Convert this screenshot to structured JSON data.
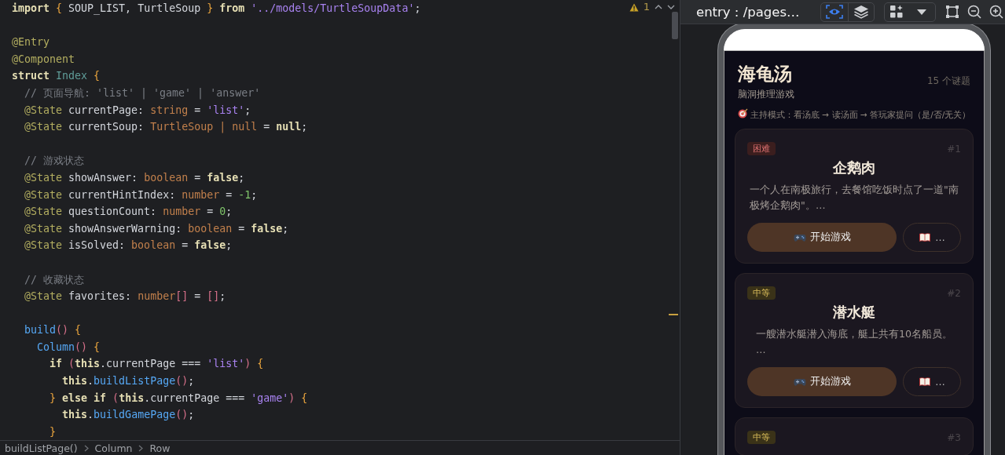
{
  "editor": {
    "warnings": "1",
    "lines": [
      {
        "kind": "code",
        "tokens": [
          {
            "kind": "kw",
            "text": "import "
          },
          {
            "kind": "brace",
            "text": "{"
          },
          {
            "kind": "plain",
            "text": " SOUP_LIST, TurtleSoup "
          },
          {
            "kind": "brace",
            "text": "}"
          },
          {
            "kind": "kw",
            "text": " from "
          },
          {
            "kind": "str",
            "text": "'../models/TurtleSoupData'"
          },
          {
            "kind": "plain",
            "text": ";"
          }
        ]
      },
      {
        "kind": "blank"
      },
      {
        "kind": "code",
        "tokens": [
          {
            "kind": "ann",
            "text": "@Entry"
          }
        ]
      },
      {
        "kind": "code",
        "tokens": [
          {
            "kind": "ann",
            "text": "@Component"
          }
        ]
      },
      {
        "kind": "code",
        "tokens": [
          {
            "kind": "kw",
            "text": "struct "
          },
          {
            "kind": "cls",
            "text": "Index "
          },
          {
            "kind": "brace",
            "text": "{"
          }
        ]
      },
      {
        "kind": "code",
        "tokens": [
          {
            "kind": "comment",
            "text": "  // 页面导航: 'list' | 'game' | 'answer'"
          }
        ]
      },
      {
        "kind": "code",
        "tokens": [
          {
            "kind": "ann",
            "text": "  @State"
          },
          {
            "kind": "plain",
            "text": " currentPage: "
          },
          {
            "kind": "type",
            "text": "string"
          },
          {
            "kind": "plain",
            "text": " = "
          },
          {
            "kind": "str",
            "text": "'list'"
          },
          {
            "kind": "plain",
            "text": ";"
          }
        ]
      },
      {
        "kind": "code",
        "tokens": [
          {
            "kind": "ann",
            "text": "  @State"
          },
          {
            "kind": "plain",
            "text": " currentSoup: "
          },
          {
            "kind": "type",
            "text": "TurtleSoup | null"
          },
          {
            "kind": "plain",
            "text": " = "
          },
          {
            "kind": "kw",
            "text": "null"
          },
          {
            "kind": "plain",
            "text": ";"
          }
        ]
      },
      {
        "kind": "blank"
      },
      {
        "kind": "code",
        "tokens": [
          {
            "kind": "comment",
            "text": "  // 游戏状态"
          }
        ]
      },
      {
        "kind": "code",
        "tokens": [
          {
            "kind": "ann",
            "text": "  @State"
          },
          {
            "kind": "plain",
            "text": " showAnswer: "
          },
          {
            "kind": "type",
            "text": "boolean"
          },
          {
            "kind": "plain",
            "text": " = "
          },
          {
            "kind": "kw",
            "text": "false"
          },
          {
            "kind": "plain",
            "text": ";"
          }
        ]
      },
      {
        "kind": "code",
        "tokens": [
          {
            "kind": "ann",
            "text": "  @State"
          },
          {
            "kind": "plain",
            "text": " currentHintIndex: "
          },
          {
            "kind": "type",
            "text": "number"
          },
          {
            "kind": "plain",
            "text": " = "
          },
          {
            "kind": "num",
            "text": "-1"
          },
          {
            "kind": "plain",
            "text": ";"
          }
        ]
      },
      {
        "kind": "code",
        "tokens": [
          {
            "kind": "ann",
            "text": "  @State"
          },
          {
            "kind": "plain",
            "text": " questionCount: "
          },
          {
            "kind": "type",
            "text": "number"
          },
          {
            "kind": "plain",
            "text": " = "
          },
          {
            "kind": "num",
            "text": "0"
          },
          {
            "kind": "plain",
            "text": ";"
          }
        ]
      },
      {
        "kind": "code",
        "tokens": [
          {
            "kind": "ann",
            "text": "  @State"
          },
          {
            "kind": "plain",
            "text": " showAnswerWarning: "
          },
          {
            "kind": "type",
            "text": "boolean"
          },
          {
            "kind": "plain",
            "text": " = "
          },
          {
            "kind": "kw",
            "text": "false"
          },
          {
            "kind": "plain",
            "text": ";"
          }
        ]
      },
      {
        "kind": "code",
        "tokens": [
          {
            "kind": "ann",
            "text": "  @State"
          },
          {
            "kind": "plain",
            "text": " isSolved: "
          },
          {
            "kind": "type",
            "text": "boolean"
          },
          {
            "kind": "plain",
            "text": " = "
          },
          {
            "kind": "kw",
            "text": "false"
          },
          {
            "kind": "plain",
            "text": ";"
          }
        ]
      },
      {
        "kind": "blank"
      },
      {
        "kind": "code",
        "tokens": [
          {
            "kind": "comment",
            "text": "  // 收藏状态"
          }
        ]
      },
      {
        "kind": "code",
        "tokens": [
          {
            "kind": "ann",
            "text": "  @State"
          },
          {
            "kind": "plain",
            "text": " favorites: "
          },
          {
            "kind": "type",
            "text": "number"
          },
          {
            "kind": "paren",
            "text": "[]"
          },
          {
            "kind": "plain",
            "text": " = "
          },
          {
            "kind": "paren",
            "text": "[]"
          },
          {
            "kind": "plain",
            "text": ";"
          }
        ]
      },
      {
        "kind": "blank"
      },
      {
        "kind": "code",
        "tokens": [
          {
            "kind": "fn",
            "text": "  build"
          },
          {
            "kind": "paren",
            "text": "()"
          },
          {
            "kind": "brace",
            "text": " {"
          }
        ]
      },
      {
        "kind": "code",
        "tokens": [
          {
            "kind": "fn",
            "text": "    Column"
          },
          {
            "kind": "paren",
            "text": "()"
          },
          {
            "kind": "brace",
            "text": " {"
          }
        ]
      },
      {
        "kind": "code",
        "tokens": [
          {
            "kind": "kw",
            "text": "      if "
          },
          {
            "kind": "paren",
            "text": "("
          },
          {
            "kind": "kw",
            "text": "this"
          },
          {
            "kind": "plain",
            "text": ".currentPage === "
          },
          {
            "kind": "str",
            "text": "'list'"
          },
          {
            "kind": "paren",
            "text": ")"
          },
          {
            "kind": "brace",
            "text": " {"
          }
        ]
      },
      {
        "kind": "code",
        "tokens": [
          {
            "kind": "kw",
            "text": "        this"
          },
          {
            "kind": "plain",
            "text": "."
          },
          {
            "kind": "fn",
            "text": "buildListPage"
          },
          {
            "kind": "paren",
            "text": "()"
          },
          {
            "kind": "plain",
            "text": ";"
          }
        ]
      },
      {
        "kind": "code",
        "tokens": [
          {
            "kind": "brace",
            "text": "      }"
          },
          {
            "kind": "kw",
            "text": " else if "
          },
          {
            "kind": "paren",
            "text": "("
          },
          {
            "kind": "kw",
            "text": "this"
          },
          {
            "kind": "plain",
            "text": ".currentPage === "
          },
          {
            "kind": "str",
            "text": "'game'"
          },
          {
            "kind": "paren",
            "text": ")"
          },
          {
            "kind": "brace",
            "text": " {"
          }
        ]
      },
      {
        "kind": "code",
        "tokens": [
          {
            "kind": "kw",
            "text": "        this"
          },
          {
            "kind": "plain",
            "text": "."
          },
          {
            "kind": "fn",
            "text": "buildGamePage"
          },
          {
            "kind": "paren",
            "text": "()"
          },
          {
            "kind": "plain",
            "text": ";"
          }
        ]
      },
      {
        "kind": "code",
        "tokens": [
          {
            "kind": "brace",
            "text": "      }"
          }
        ]
      }
    ],
    "breadcrumbs": [
      "buildListPage()",
      "Column",
      "Row"
    ]
  },
  "preview": {
    "title": "entry : /pages…",
    "view_toggles": [
      {
        "kind": "inspect",
        "selected": true
      },
      {
        "kind": "layers",
        "selected": false
      }
    ],
    "app": {
      "title": "海龟汤",
      "count": "15 个谜题",
      "subtitle": "脑洞推理游戏",
      "mode_hint": "主持模式：看汤底 → 读汤面 → 答玩家提问（是/否/无关）",
      "cards": [
        {
          "difficulty": "困难",
          "color": "#3b1e1e",
          "number": "#1",
          "title": "企鹅肉",
          "teaser_lines": [
            "一个人在南极旅行，去餐馆吃饭时点了一道\"南",
            "极烤企鹅肉\"。…"
          ],
          "start": "开始游戏",
          "more": "…"
        },
        {
          "difficulty": "中等",
          "color": "#3a3218",
          "number": "#2",
          "title": "潜水艇",
          "teaser_lines": [
            "一艘潜水艇潜入海底，艇上共有10名船员。",
            "…"
          ],
          "start": "开始游戏",
          "more": "…"
        },
        {
          "difficulty": "中等",
          "color": "#3a3218",
          "number": "#3"
        }
      ]
    }
  }
}
